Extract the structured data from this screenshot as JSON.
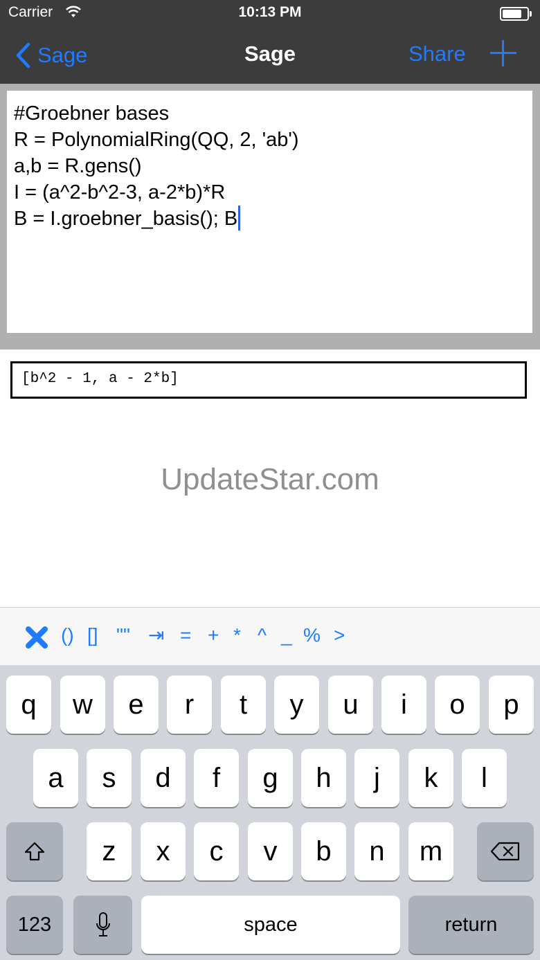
{
  "status_bar": {
    "carrier": "Carrier",
    "time": "10:13 PM",
    "battery_level": 0.8
  },
  "nav_bar": {
    "back_label": "Sage",
    "title": "Sage",
    "share_label": "Share",
    "add_icon": "plus-icon"
  },
  "editor": {
    "lines": [
      "#Groebner bases",
      "R = PolynomialRing(QQ, 2, 'ab')",
      "a,b = R.gens()",
      "I = (a^2-b^2-3, a-2*b)*R",
      "B = I.groebner_basis(); B"
    ]
  },
  "output": {
    "text": "[b^2 - 1, a - 2*b]"
  },
  "watermark": "UpdateStar.com",
  "accessory_bar": {
    "close_icon": "close-x-icon",
    "keys": [
      "()",
      "[]",
      "\"\"",
      "⇥",
      "=",
      "+",
      "*",
      "^",
      "_",
      "%",
      ">"
    ]
  },
  "keyboard": {
    "row1": [
      "q",
      "w",
      "e",
      "r",
      "t",
      "y",
      "u",
      "i",
      "o",
      "p"
    ],
    "row2": [
      "a",
      "s",
      "d",
      "f",
      "g",
      "h",
      "j",
      "k",
      "l"
    ],
    "row3": [
      "z",
      "x",
      "c",
      "v",
      "b",
      "n",
      "m"
    ],
    "shift_icon": "shift-icon",
    "delete_icon": "backspace-icon",
    "numbers_label": "123",
    "mic_icon": "microphone-icon",
    "space_label": "space",
    "return_label": "return",
    "colors": {
      "accent": "#1f7bff",
      "nav_background": "#3c3c3c",
      "keyboard_background": "#d1d4da",
      "caret": "#2a60e6"
    }
  }
}
